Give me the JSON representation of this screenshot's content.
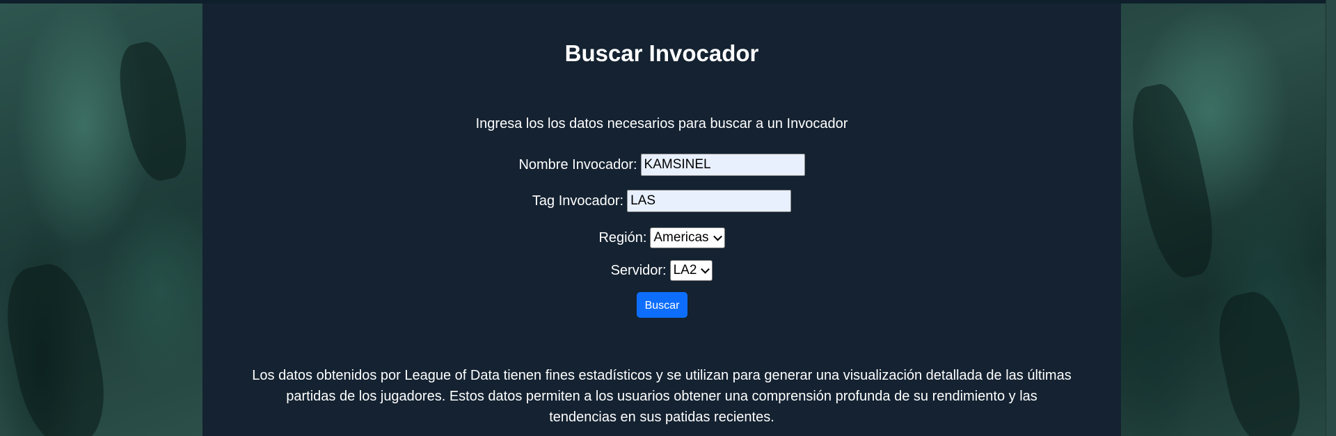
{
  "page": {
    "title": "Buscar Invocador",
    "intro": "Ingresa los los datos necesarios para buscar a un Invocador"
  },
  "form": {
    "summoner_name_label": "Nombre Invocador:",
    "summoner_name_value": "KAMSINEL",
    "tag_label": "Tag Invocador:",
    "tag_value": "LAS",
    "region_label": "Región:",
    "region_selected": "Americas",
    "server_label": "Servidor:",
    "server_selected": "LA2",
    "submit_label": "Buscar"
  },
  "footer": {
    "disclaimer": "Los datos obtenidos por League of Data tienen fines estadísticos y se utilizan para generar una visualización detallada de las últimas partidas de los jugadores. Estos datos permiten a los usuarios obtener una comprensión profunda de su rendimiento y las tendencias en sus patidas recientes."
  },
  "colors": {
    "panel_bg": "#142231",
    "button_bg": "#0d6efd",
    "input_bg": "#e8f0fe"
  }
}
